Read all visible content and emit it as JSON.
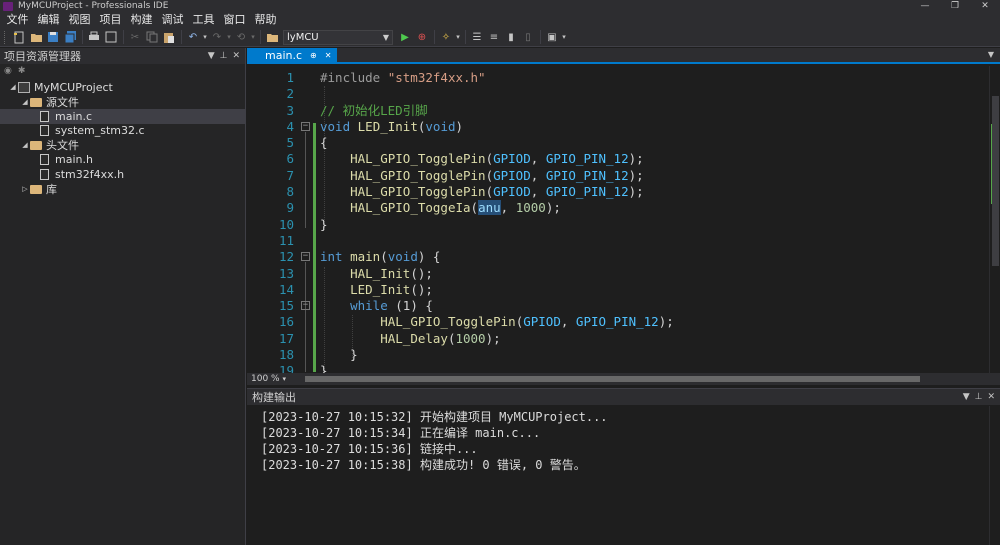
{
  "window": {
    "title": "MyMCUProject - Professionals IDE",
    "controls": [
      "—",
      "❐",
      "✕"
    ]
  },
  "menu": [
    "文件",
    "编辑",
    "视图",
    "项目",
    "构建",
    "调试",
    "工具",
    "窗口",
    "帮助"
  ],
  "toolbar": {
    "config_value": "lyMCU"
  },
  "explorer": {
    "title": "项目资源管理器",
    "items": [
      {
        "label": "MyMCUProject",
        "level": 0,
        "kind": "project",
        "expanded": true
      },
      {
        "label": "源文件",
        "level": 1,
        "kind": "folder",
        "expanded": true
      },
      {
        "label": "main.c",
        "level": 2,
        "kind": "file",
        "selected": true
      },
      {
        "label": "system_stm32.c",
        "level": 2,
        "kind": "file"
      },
      {
        "label": "头文件",
        "level": 1,
        "kind": "folder",
        "expanded": true
      },
      {
        "label": "main.h",
        "level": 2,
        "kind": "file"
      },
      {
        "label": "stm32f4xx.h",
        "level": 2,
        "kind": "file"
      },
      {
        "label": "库",
        "level": 1,
        "kind": "folder",
        "expanded": false
      }
    ]
  },
  "editor": {
    "tab_label": "main.c",
    "zoom": "100 %",
    "line_numbers": [
      "1",
      "2",
      "3",
      "4",
      "5",
      "6",
      "7",
      "8",
      "9",
      "10",
      "11",
      "12",
      "13",
      "14",
      "15",
      "16",
      "17",
      "18",
      "19"
    ],
    "code": {
      "l1_pp": "#include ",
      "l1_str": "\"stm32f4xx.h\"",
      "l3_comment": "// 初始化LED引脚",
      "l4_kw": "void",
      "l4_fn": "LED_Init",
      "l4_open": "(",
      "l4_kw2": "void",
      "l4_close": ")",
      "l5": "{",
      "toggle_fn": "HAL_GPIO_TogglePin",
      "gpiod": "GPIOD",
      "pin12": "GPIO_PIN_12",
      "l9_fn": "HAL_GPIO_ToggeIa",
      "l9_paren": "(",
      "l9_hint": "anu",
      "l9_rest": ", ",
      "l9_num": "1000",
      "l9_end": ");",
      "l10": "}",
      "l12_kw": "int",
      "l12_fn": "main",
      "l12_kw2": "void",
      "l12_end": ") {",
      "hal_init": "HAL_Init",
      "led_init": "LED_Init",
      "while_kw": "while",
      "while_rest": " (1) {",
      "delay_fn": "HAL_Delay",
      "delay_num": "1000",
      "l18": "}",
      "l19": "}"
    }
  },
  "output": {
    "title": "构建输出",
    "lines": [
      "[2023-10-27 10:15:32] 开始构建项目 MyMCUProject...",
      "[2023-10-27 10:15:34] 正在编译 main.c...",
      "[2023-10-27 10:15:36] 链接中...",
      "[2023-10-27 10:15:38] 构建成功! 0 错误, 0 警告。"
    ]
  },
  "colors": {
    "accent": "#007acc",
    "keyword": "#569cd6",
    "comment": "#57a64a",
    "string": "#d69d85",
    "function": "#dcdcaa",
    "macro": "#4fc1ff",
    "number": "#b5cea8"
  }
}
